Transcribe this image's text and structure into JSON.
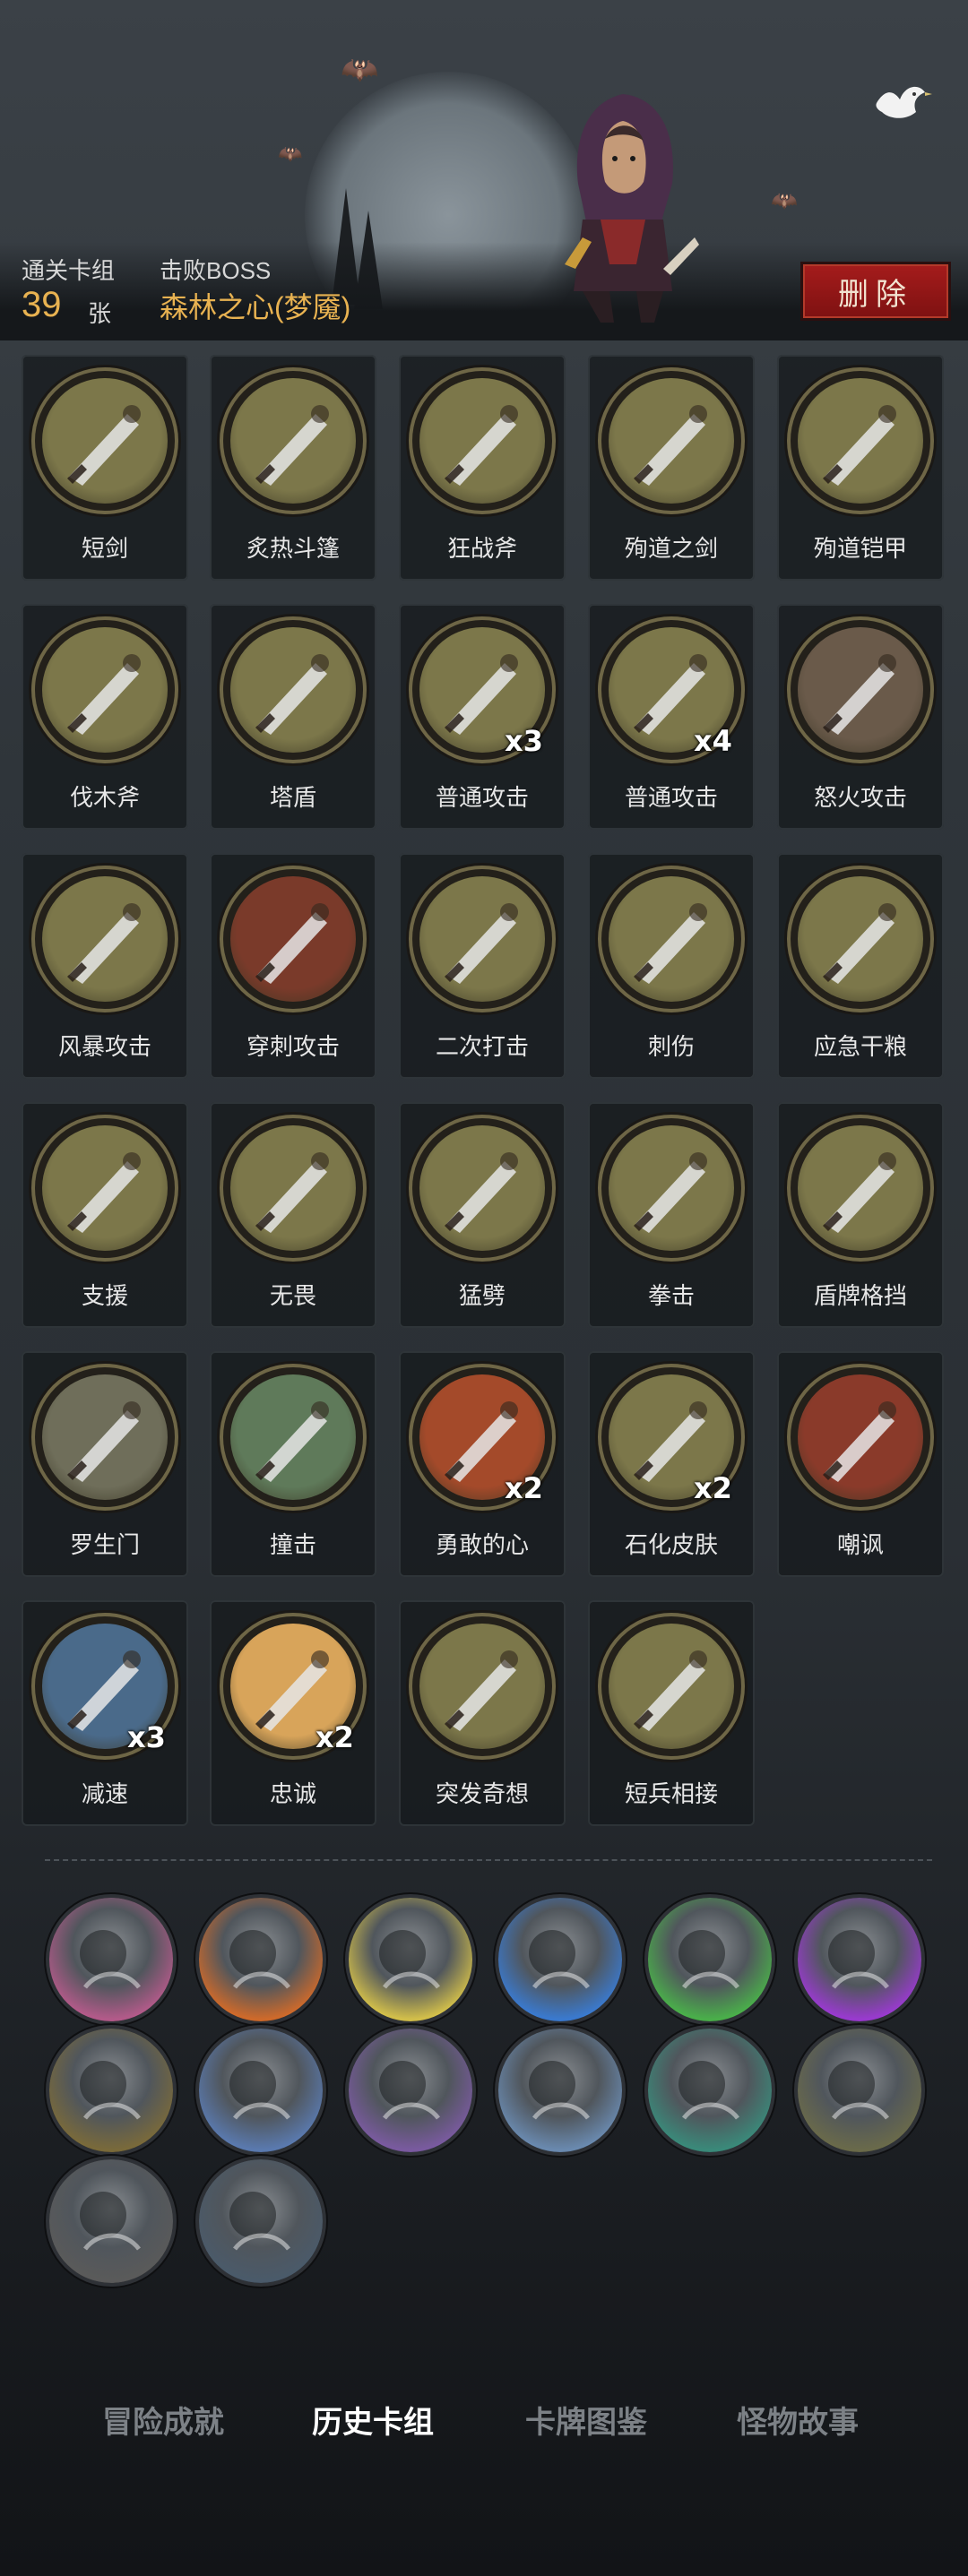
{
  "header": {
    "cleared_label": "通关卡组",
    "card_count": "39",
    "card_unit": "张",
    "boss_label": "击败BOSS",
    "boss_name": "森林之心(梦魇)",
    "delete_label": "删除"
  },
  "cards": [
    {
      "name": "短剑",
      "mult": "",
      "icon": "dagger-icon",
      "bg": "#7c774a"
    },
    {
      "name": "炙热斗篷",
      "mult": "",
      "icon": "cloak-icon",
      "bg": "#7c774a"
    },
    {
      "name": "狂战斧",
      "mult": "",
      "icon": "axe-icon",
      "bg": "#7c774a"
    },
    {
      "name": "殉道之剑",
      "mult": "",
      "icon": "martyr-sword-icon",
      "bg": "#7c774a"
    },
    {
      "name": "殉道铠甲",
      "mult": "",
      "icon": "martyr-armor-icon",
      "bg": "#7c774a"
    },
    {
      "name": "伐木斧",
      "mult": "",
      "icon": "hatchet-icon",
      "bg": "#7c774a"
    },
    {
      "name": "塔盾",
      "mult": "",
      "icon": "tower-shield-icon",
      "bg": "#7c774a"
    },
    {
      "name": "普通攻击",
      "mult": "x3",
      "icon": "sword-strike-icon",
      "bg": "#7c774a"
    },
    {
      "name": "普通攻击",
      "mult": "x4",
      "icon": "sword-strike-gold-icon",
      "bg": "#7c774a"
    },
    {
      "name": "怒火攻击",
      "mult": "",
      "icon": "fury-attack-icon",
      "bg": "#6a5a4a"
    },
    {
      "name": "风暴攻击",
      "mult": "",
      "icon": "storm-attack-icon",
      "bg": "#7c774a"
    },
    {
      "name": "穿刺攻击",
      "mult": "",
      "icon": "pierce-attack-icon",
      "bg": "#7a3a2a"
    },
    {
      "name": "二次打击",
      "mult": "",
      "icon": "double-strike-icon",
      "bg": "#7c774a"
    },
    {
      "name": "刺伤",
      "mult": "",
      "icon": "stab-icon",
      "bg": "#7c774a"
    },
    {
      "name": "应急干粮",
      "mult": "",
      "icon": "ration-icon",
      "bg": "#7c774a"
    },
    {
      "name": "支援",
      "mult": "",
      "icon": "support-icon",
      "bg": "#7c774a"
    },
    {
      "name": "无畏",
      "mult": "",
      "icon": "fearless-icon",
      "bg": "#7c774a"
    },
    {
      "name": "猛劈",
      "mult": "",
      "icon": "cleave-icon",
      "bg": "#7c774a"
    },
    {
      "name": "拳击",
      "mult": "",
      "icon": "punch-icon",
      "bg": "#7c774a"
    },
    {
      "name": "盾牌格挡",
      "mult": "",
      "icon": "shield-block-icon",
      "bg": "#7c774a"
    },
    {
      "name": "罗生门",
      "mult": "",
      "icon": "rashomon-icon",
      "bg": "#6f6e5a"
    },
    {
      "name": "撞击",
      "mult": "",
      "icon": "ram-icon",
      "bg": "#5f7a5a"
    },
    {
      "name": "勇敢的心",
      "mult": "x2",
      "icon": "brave-heart-icon",
      "bg": "#a44a2a"
    },
    {
      "name": "石化皮肤",
      "mult": "x2",
      "icon": "stone-skin-icon",
      "bg": "#7c774a"
    },
    {
      "name": "嘲讽",
      "mult": "",
      "icon": "taunt-icon",
      "bg": "#8a3a2a"
    },
    {
      "name": "减速",
      "mult": "x3",
      "icon": "slow-icon",
      "bg": "#4a6a8a"
    },
    {
      "name": "忠诚",
      "mult": "x2",
      "icon": "loyalty-icon",
      "bg": "#d8a45a"
    },
    {
      "name": "突发奇想",
      "mult": "",
      "icon": "whim-icon",
      "bg": "#7c774a"
    },
    {
      "name": "短兵相接",
      "mult": "",
      "icon": "close-combat-icon",
      "bg": "#7c774a"
    }
  ],
  "relics": [
    {
      "icon": "relic-pink-beast-icon",
      "color": "#b45a8a"
    },
    {
      "icon": "relic-orange-beast-icon",
      "color": "#d06a2a"
    },
    {
      "icon": "relic-yellow-beast-icon",
      "color": "#d4c04a"
    },
    {
      "icon": "relic-blue-beast-icon",
      "color": "#3a7ad0"
    },
    {
      "icon": "relic-green-beast-icon",
      "color": "#4ab04a"
    },
    {
      "icon": "relic-purple-beast-icon",
      "color": "#9a3ad0"
    },
    {
      "icon": "relic-warrior-icon",
      "color": "#7a6a3a"
    },
    {
      "icon": "relic-blue-clock-icon",
      "color": "#5a7ab0"
    },
    {
      "icon": "relic-purple-ghost-icon",
      "color": "#7a5aa0"
    },
    {
      "icon": "relic-clock-icon",
      "color": "#6a8ab0"
    },
    {
      "icon": "relic-teal-door-icon",
      "color": "#3a8a7a"
    },
    {
      "icon": "relic-skeleton-icon",
      "color": "#6a6a4a"
    },
    {
      "icon": "relic-blade-icon",
      "color": "#5a5a5a"
    },
    {
      "icon": "relic-shovel-icon",
      "color": "#4a5a6a"
    }
  ],
  "nav": {
    "achievements": "冒险成就",
    "history_deck": "历史卡组",
    "card_codex": "卡牌图鉴",
    "monster_story": "怪物故事"
  }
}
